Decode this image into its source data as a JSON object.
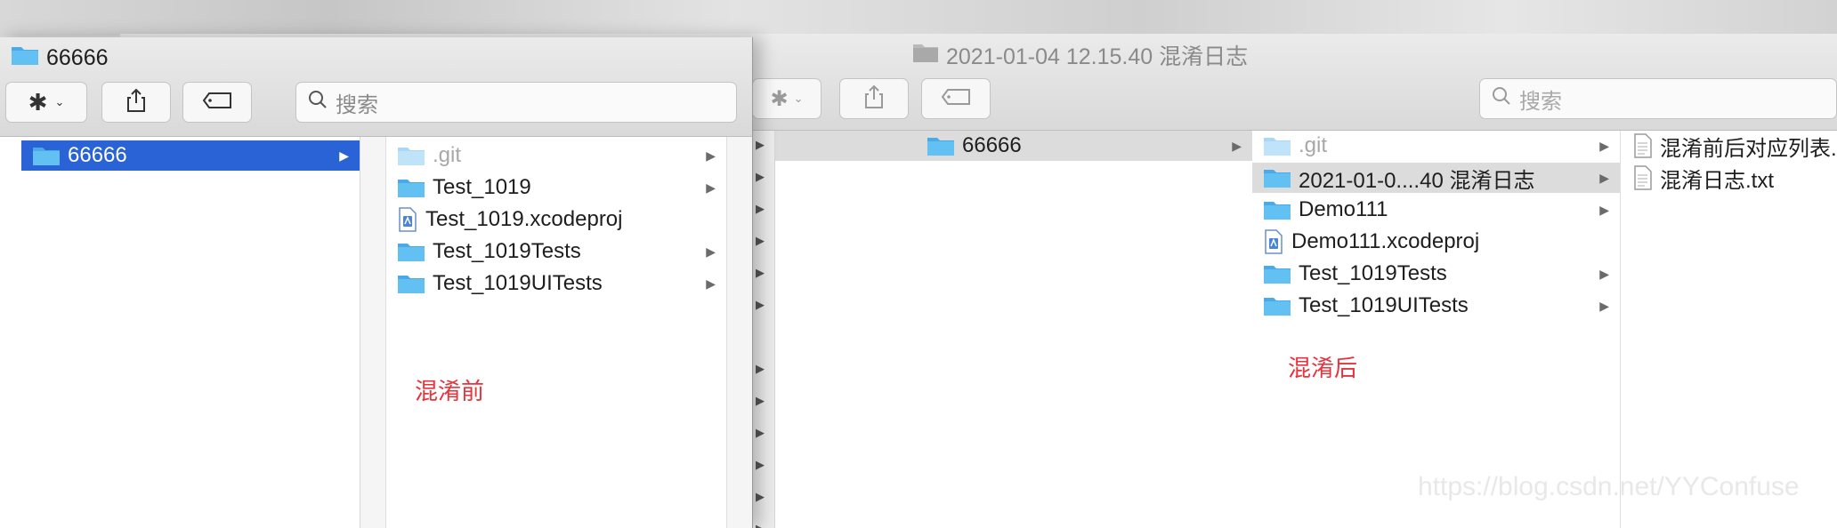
{
  "back_window": {
    "title": "2021-01-04 12.15.40 混淆日志",
    "search_placeholder": "搜索",
    "col1": [
      {
        "label": "66666",
        "icon": "folder"
      }
    ],
    "col2": [
      {
        "label": ".git",
        "icon": "folder-light",
        "dim": true,
        "arrow": true
      },
      {
        "label": "2021-01-0....40 混淆日志",
        "icon": "folder",
        "arrow": true,
        "selected": true
      },
      {
        "label": "Demo111",
        "icon": "folder",
        "arrow": true
      },
      {
        "label": "Demo111.xcodeproj",
        "icon": "xcodeproj",
        "arrow": false
      },
      {
        "label": "Test_1019Tests",
        "icon": "folder",
        "arrow": true
      },
      {
        "label": "Test_1019UITests",
        "icon": "folder",
        "arrow": true
      }
    ],
    "col3": [
      {
        "label": "混淆前后对应列表.txt",
        "icon": "document"
      },
      {
        "label": "混淆日志.txt",
        "icon": "document"
      }
    ],
    "annotation": "混淆后"
  },
  "front_window": {
    "title": "66666",
    "search_placeholder": "搜索",
    "col1": [
      {
        "label": "66666",
        "icon": "folder",
        "selected": true
      }
    ],
    "col2": [
      {
        "label": ".git",
        "icon": "folder-light",
        "dim": true,
        "arrow": true
      },
      {
        "label": "Test_1019",
        "icon": "folder",
        "arrow": true
      },
      {
        "label": "Test_1019.xcodeproj",
        "icon": "xcodeproj",
        "arrow": false
      },
      {
        "label": "Test_1019Tests",
        "icon": "folder",
        "arrow": true
      },
      {
        "label": "Test_1019UITests",
        "icon": "folder",
        "arrow": true
      }
    ],
    "annotation": "混淆前"
  },
  "watermark": "https://blog.csdn.net/YYConfuse",
  "colors": {
    "selection": "#2a63d6",
    "annotation": "#e8323c",
    "folder": "#5bb8f0"
  }
}
